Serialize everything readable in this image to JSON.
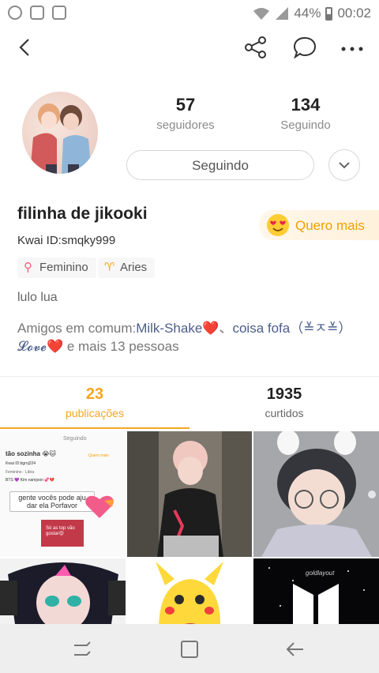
{
  "status_bar": {
    "battery": "44%",
    "time": "00:02",
    "left_icons": [
      "whatsapp-icon",
      "photo-icon",
      "gallery-icon"
    ]
  },
  "header": {
    "icons": [
      "back-arrow-icon",
      "share-icon",
      "chat-bubble-icon",
      "more-dots-icon"
    ]
  },
  "profile": {
    "followers_count": "57",
    "followers_label": "seguidores",
    "following_count": "134",
    "following_label": "Seguindo",
    "follow_button": "Seguindo",
    "name": "filinha de jikooki",
    "kwai_id": "Kwai ID:smqky999",
    "quero_mais": "Quero mais",
    "tags": [
      "Feminino",
      "Aries"
    ],
    "bio": "lulo lua",
    "mutual_prefix": "Amigos em comum:",
    "mutual_friend_1": "Milk-Shake",
    "mutual_heart_1": "❤️",
    "mutual_sep": "、",
    "mutual_friend_2": "coisa fofa",
    "mutual_friend_2_suffix": "（≚ㅈ≚）",
    "mutual_friend_3": "𝓛𝓸𝓿𝓮",
    "mutual_heart_2": "❤️",
    "mutual_suffix": " e mais 13 pessoas"
  },
  "tabs": [
    {
      "count": "23",
      "label": "publicações",
      "active": true
    },
    {
      "count": "1935",
      "label": "curtidos",
      "active": false
    }
  ],
  "grid_tile_1": {
    "top_label": "Seguindo",
    "name": "tão sozinha 😭🐱",
    "kwai": "Kwai ID:bgrnj224",
    "tags": "Feminino · Libra",
    "bts": "BTS 💜 Kim namjoon 💞💔",
    "quero": "Quero mais",
    "caption": "gente vocês pode aju dar ela Porfavor",
    "sub_caption": "Só as top vão gostar😍"
  },
  "grid_tile_6": {
    "text": "goldlayout"
  },
  "colors": {
    "accent": "#f5a623",
    "mutual_link": "#4c5e8c",
    "heart": "#e2262b",
    "tag_icon": "#f35d79"
  }
}
